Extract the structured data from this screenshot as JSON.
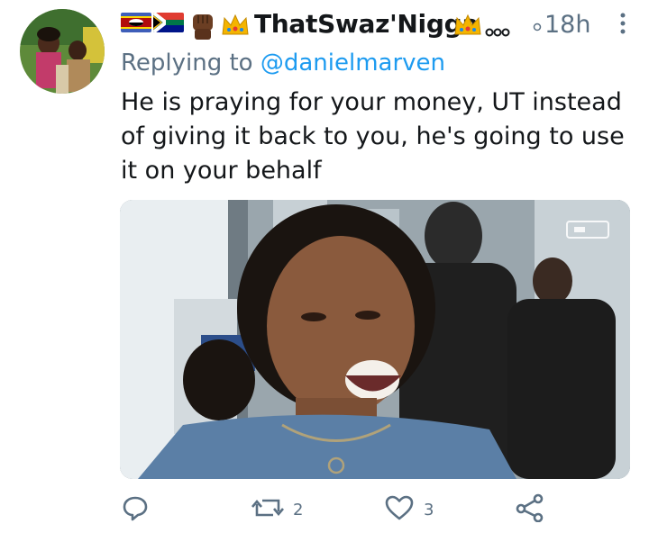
{
  "tweet": {
    "display_name": "ThatSwaz'Nigga",
    "timestamp": "18h",
    "reply_prefix": "Replying to",
    "reply_handle": "@danielmarven",
    "text": "He is praying for your money, UT instead of giving it back to you, he's going to use it on your behalf"
  },
  "actions": {
    "retweets": "2",
    "likes": "3"
  },
  "icons": {
    "reply": "reply-icon",
    "retweet": "retweet-icon",
    "like": "heart-icon",
    "share": "share-icon",
    "more": "more-vertical-icon"
  },
  "colors": {
    "link": "#1d9bf0",
    "muted": "#5b7083",
    "text": "#14171a"
  }
}
